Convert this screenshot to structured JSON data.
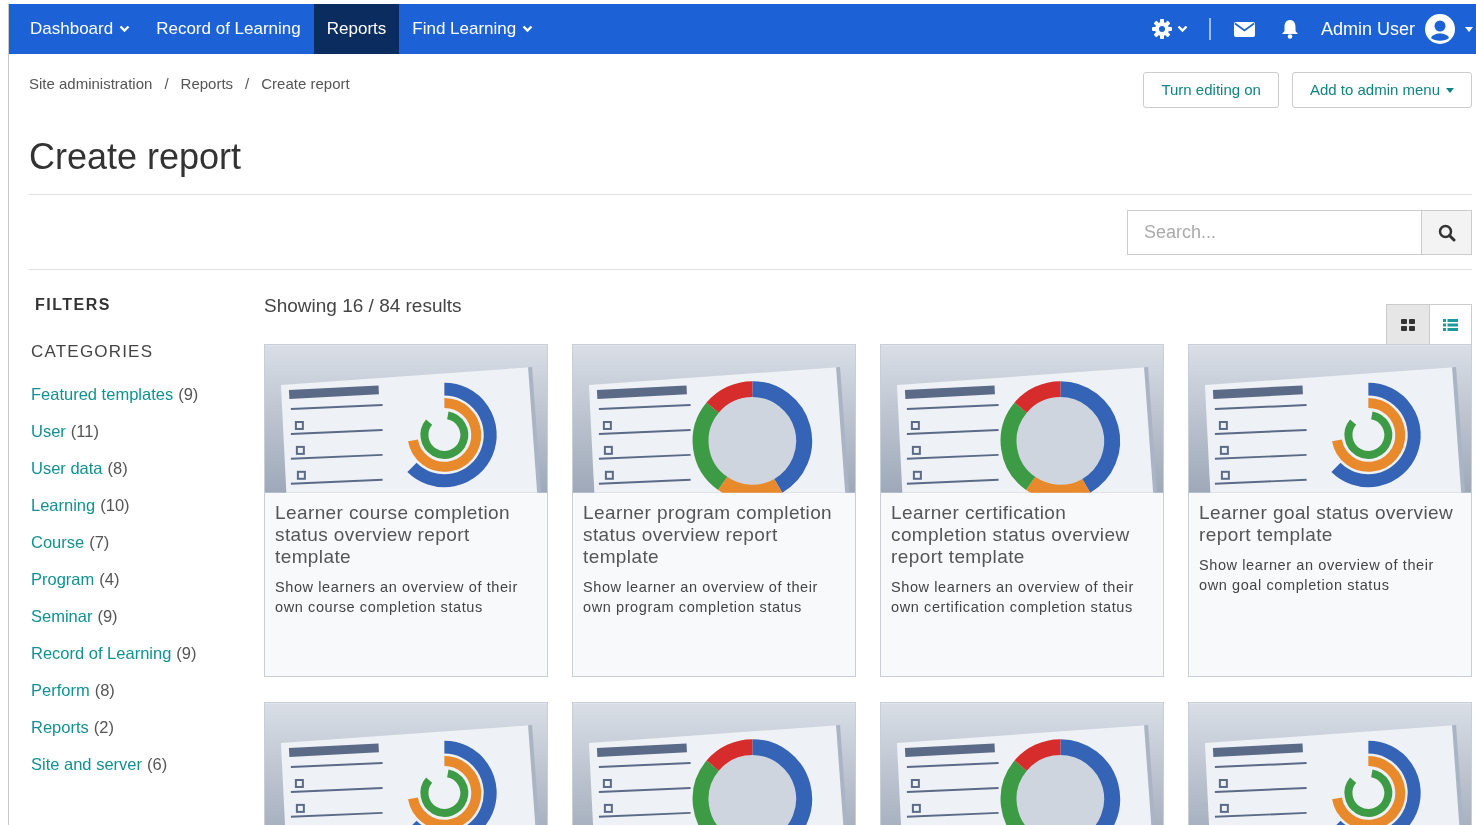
{
  "nav": {
    "items": [
      {
        "label": "Dashboard",
        "dropdown": true,
        "selected": false
      },
      {
        "label": "Record of Learning",
        "dropdown": false,
        "selected": false
      },
      {
        "label": "Reports",
        "dropdown": false,
        "selected": true
      },
      {
        "label": "Find Learning",
        "dropdown": true,
        "selected": false
      }
    ],
    "user": "Admin User"
  },
  "breadcrumbs": [
    "Site administration",
    "Reports",
    "Create report"
  ],
  "breadcrumb_separator": "/",
  "actions": [
    {
      "label": "Turn editing on",
      "dropdown": false
    },
    {
      "label": "Add to admin menu",
      "dropdown": true
    }
  ],
  "title": "Create report",
  "search": {
    "placeholder": "Search..."
  },
  "filters": {
    "heading": "FILTERS",
    "section": "CATEGORIES",
    "items": [
      {
        "label": "Featured templates",
        "count": "(9)"
      },
      {
        "label": "User",
        "count": "(11)"
      },
      {
        "label": "User data",
        "count": "(8)"
      },
      {
        "label": "Learning",
        "count": "(10)"
      },
      {
        "label": "Course",
        "count": "(7)"
      },
      {
        "label": "Program",
        "count": "(4)"
      },
      {
        "label": "Seminar",
        "count": "(9)"
      },
      {
        "label": "Record of Learning",
        "count": "(9)"
      },
      {
        "label": "Perform",
        "count": "(8)"
      },
      {
        "label": "Reports",
        "count": "(2)"
      },
      {
        "label": "Site and server",
        "count": "(6)"
      }
    ]
  },
  "results": "Showing 16 / 84 results",
  "view_toggle": [
    {
      "kind": "grid",
      "selected": true
    },
    {
      "kind": "list",
      "selected": false
    }
  ],
  "cards": [
    {
      "kind": "rings",
      "title": "Learner course completion status overview report template",
      "description": "Show learners an overview of their own course completion status"
    },
    {
      "kind": "donut",
      "title": "Learner program completion status overview report template",
      "description": "Show learner an overview of their own program completion status"
    },
    {
      "kind": "donut",
      "title": "Learner certification completion status overview report template",
      "description": "Show learners an overview of their own certification completion status"
    },
    {
      "kind": "rings",
      "title": "Learner goal status overview report template",
      "description": "Show learner an overview of their own goal completion status"
    },
    {
      "kind": "rings"
    },
    {
      "kind": "donut"
    },
    {
      "kind": "donut"
    },
    {
      "kind": "rings"
    }
  ]
}
